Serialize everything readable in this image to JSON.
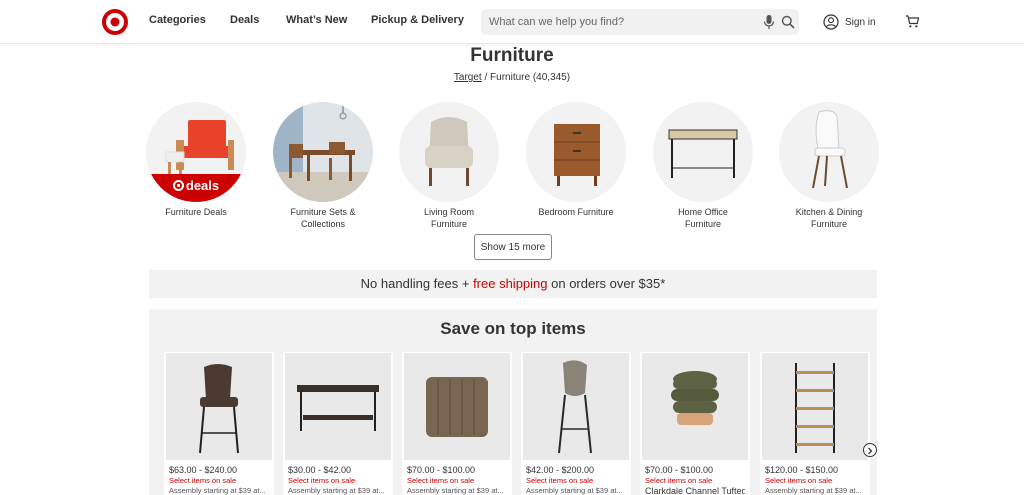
{
  "header": {
    "nav": [
      "Categories",
      "Deals",
      "What’s New",
      "Pickup & Delivery"
    ],
    "search_placeholder": "What can we help you find?",
    "sign_in": "Sign in"
  },
  "page": {
    "title": "Furniture",
    "breadcrumb_link": "Target",
    "breadcrumb_rest": " / Furniture (40,345)"
  },
  "categories": [
    {
      "label": "Furniture Deals",
      "badge": "deals"
    },
    {
      "label": "Furniture Sets & Collections"
    },
    {
      "label": "Living Room Furniture"
    },
    {
      "label": "Bedroom Furniture"
    },
    {
      "label": "Home Office Furniture"
    },
    {
      "label": "Kitchen & Dining Furniture"
    }
  ],
  "show_more": "Show 15 more",
  "banner": {
    "before": "No handling fees + ",
    "link": "free shipping",
    "after": " on orders over $35*"
  },
  "save": {
    "title": "Save on top items",
    "products": [
      {
        "price": "$63.00 - $240.00",
        "sale": "Select items on sale",
        "assembly": "Assembly starting at $39 at..."
      },
      {
        "price": "$30.00 - $42.00",
        "sale": "Select items on sale",
        "assembly": "Assembly starting at $39 at..."
      },
      {
        "price": "$70.00 - $100.00",
        "sale": "Select items on sale",
        "assembly": "Assembly starting at $39 at..."
      },
      {
        "price": "$42.00 - $200.00",
        "sale": "Select items on sale",
        "assembly": "Assembly starting at $39 at..."
      },
      {
        "price": "$70.00 - $100.00",
        "sale": "Select items on sale",
        "name": "Clarkdale Channel Tufted"
      },
      {
        "price": "$120.00 - $150.00",
        "sale": "Select items on sale",
        "assembly": "Assembly starting at $39 at..."
      }
    ]
  },
  "colors": {
    "brand_red": "#cc0000",
    "panel_gray": "#f2f2f2"
  }
}
